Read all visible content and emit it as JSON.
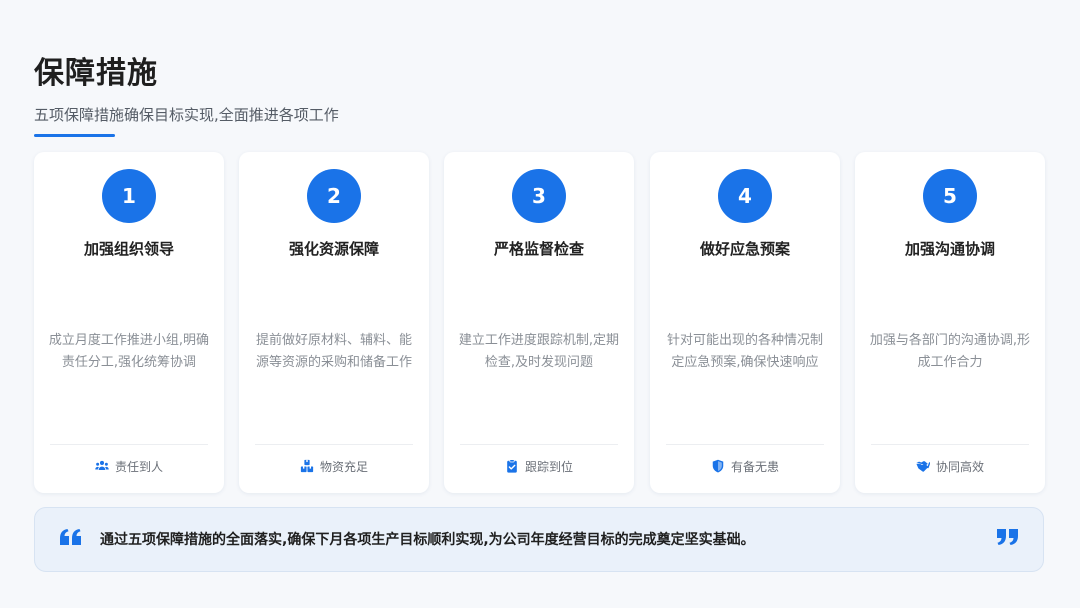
{
  "header": {
    "title": "保障措施",
    "subtitle": "五项保障措施确保目标实现,全面推进各项工作"
  },
  "colors": {
    "accent": "#1a73e8",
    "background": "#f6f8fb",
    "card": "#ffffff",
    "quote_bg": "#eaf1fa"
  },
  "cards": [
    {
      "number": "1",
      "title": "加强组织领导",
      "desc": "成立月度工作推进小组,明确责任分工,强化统筹协调",
      "footer_icon": "people-icon",
      "footer": "责任到人"
    },
    {
      "number": "2",
      "title": "强化资源保障",
      "desc": "提前做好原材料、辅料、能源等资源的采购和储备工作",
      "footer_icon": "boxes-icon",
      "footer": "物资充足"
    },
    {
      "number": "3",
      "title": "严格监督检查",
      "desc": "建立工作进度跟踪机制,定期检查,及时发现问题",
      "footer_icon": "clipboard-check-icon",
      "footer": "跟踪到位"
    },
    {
      "number": "4",
      "title": "做好应急预案",
      "desc": "针对可能出现的各种情况制定应急预案,确保快速响应",
      "footer_icon": "shield-icon",
      "footer": "有备无患"
    },
    {
      "number": "5",
      "title": "加强沟通协调",
      "desc": "加强与各部门的沟通协调,形成工作合力",
      "footer_icon": "handshake-icon",
      "footer": "协同高效"
    }
  ],
  "quote": {
    "text": "通过五项保障措施的全面落实,确保下月各项生产目标顺利实现,为公司年度经营目标的完成奠定坚实基础。"
  }
}
